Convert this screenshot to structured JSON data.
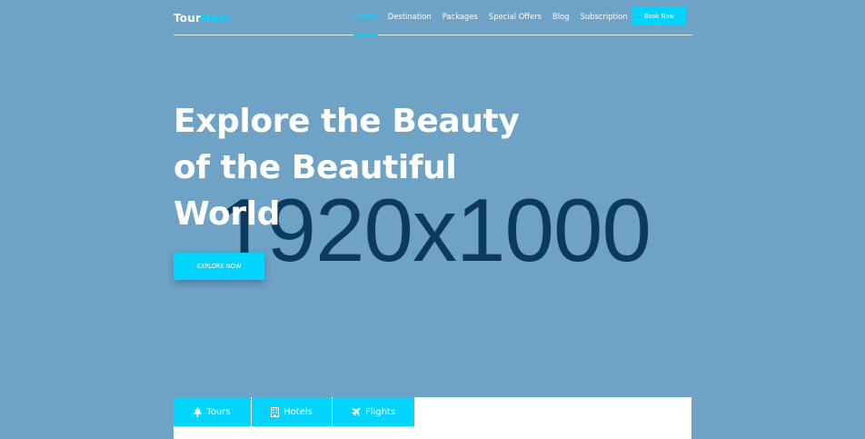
{
  "header": {
    "logo": {
      "prefix": "Tour",
      "accent": "Nest"
    },
    "nav": [
      {
        "label": "Home",
        "active": true
      },
      {
        "label": "Destination",
        "active": false
      },
      {
        "label": "Packages",
        "active": false
      },
      {
        "label": "Special Offers",
        "active": false
      },
      {
        "label": "Blog",
        "active": false
      },
      {
        "label": "Subscription",
        "active": false
      }
    ],
    "book_label": "Book Now"
  },
  "hero": {
    "title_lines": [
      "Explore the Beauty",
      "of the Beautiful",
      "World"
    ],
    "cta_label": "EXPLORE NOW",
    "placeholder_text": "1920x1000"
  },
  "booking": {
    "tabs": [
      {
        "label": "Tours",
        "icon": "tree-icon"
      },
      {
        "label": "Hotels",
        "icon": "building-icon"
      },
      {
        "label": "Flights",
        "icon": "plane-icon"
      }
    ]
  },
  "colors": {
    "background": "#6fa3c6",
    "accent": "#00d4ff",
    "placeholder_text": "#0d3a5c"
  }
}
